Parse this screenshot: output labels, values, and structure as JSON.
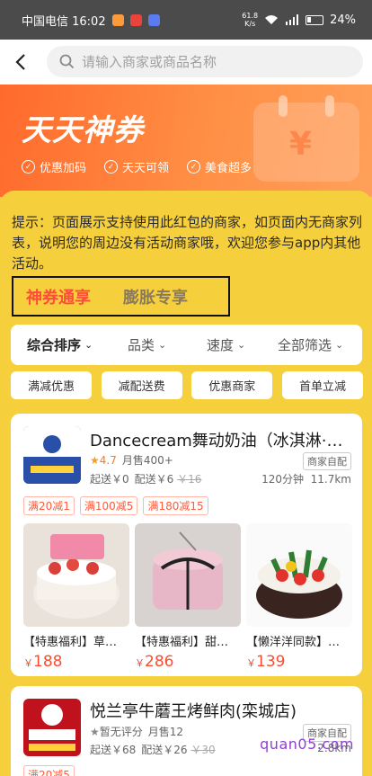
{
  "status_bar": {
    "carrier_time": "中国电信 16:02",
    "speed": "61.8\nK/s",
    "battery": "24%"
  },
  "search": {
    "placeholder": "请输入商家或商品名称"
  },
  "banner": {
    "title": "天天神券",
    "features": [
      "优惠加码",
      "天天可领",
      "美食超多"
    ]
  },
  "notice": "提示：页面展示支持使用此红包的商家，如页面内无商家列表，说明您的周边没有活动商家哦，欢迎您参与app内其他活动。",
  "tabs": [
    "神券通享",
    "膨胀专享"
  ],
  "sort_bar": [
    "综合排序",
    "品类",
    "速度",
    "全部筛选"
  ],
  "filters": [
    "满减优惠",
    "减配送费",
    "优惠商家",
    "首单立减"
  ],
  "stores": [
    {
      "name": "Dancecream舞动奶油（冰淇淋·…",
      "rating": "4.7",
      "monthly_sales": "月售400+",
      "tag": "商家自配",
      "min_order": "起送￥0",
      "delivery_fee": "配送￥6",
      "delivery_fee_original": "￥16",
      "time": "120分钟",
      "distance": "11.7km",
      "promos": [
        "满20减1",
        "满100减5",
        "满180减15"
      ],
      "items": [
        {
          "name": "【特惠福利】草…",
          "price": "188"
        },
        {
          "name": "【特惠福利】甜…",
          "price": "286"
        },
        {
          "name": "【懒洋洋同款】…",
          "price": "139"
        }
      ]
    },
    {
      "name": "悦兰亭牛蘑王烤鲜肉(栾城店)",
      "rating": "暂无评分",
      "monthly_sales": "月售12",
      "tag": "商家自配",
      "min_order": "起送￥68",
      "delivery_fee": "配送￥26",
      "delivery_fee_original": "￥30",
      "distance": "2.8km",
      "promos": [
        "满20减5"
      ]
    }
  ],
  "watermark": "quan05.com",
  "colors": {
    "accent": "#ff4b3a",
    "banner": "#ff7a36",
    "background": "#f6cf3c"
  }
}
